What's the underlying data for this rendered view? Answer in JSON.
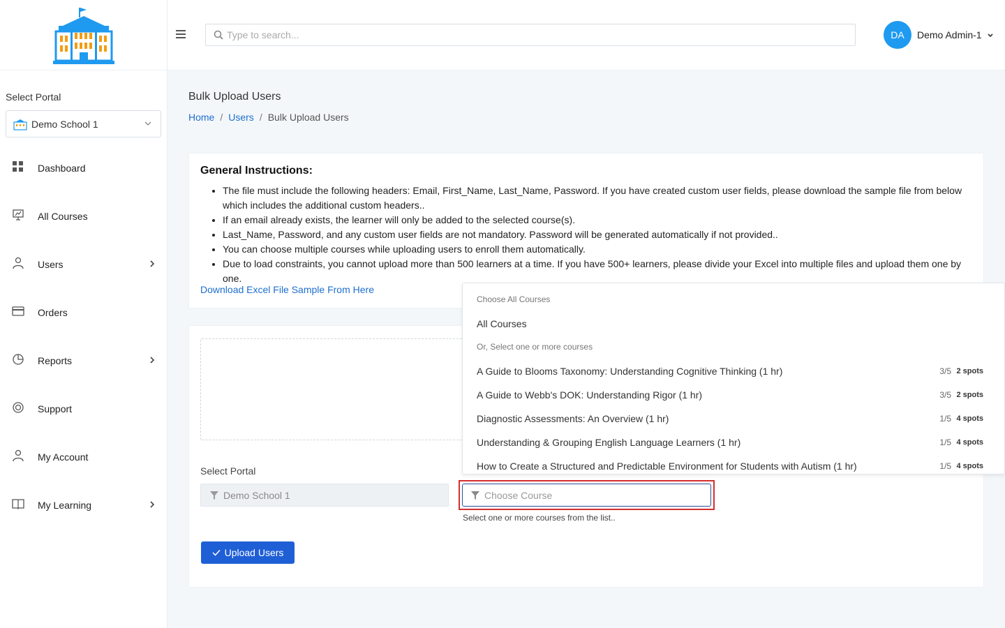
{
  "sidebar": {
    "select_portal_label": "Select Portal",
    "portal_value": "Demo School 1",
    "items": [
      {
        "label": "Dashboard",
        "icon": "dashboard-icon"
      },
      {
        "label": "All Courses",
        "icon": "presentation-icon"
      },
      {
        "label": "Users",
        "icon": "user-icon"
      },
      {
        "label": "Orders",
        "icon": "credit-card-icon"
      },
      {
        "label": "Reports",
        "icon": "pie-chart-icon"
      },
      {
        "label": "Support",
        "icon": "lifebuoy-icon"
      },
      {
        "label": "My Account",
        "icon": "user-icon"
      },
      {
        "label": "My Learning",
        "icon": "book-icon"
      }
    ]
  },
  "header": {
    "search_placeholder": "Type to search...",
    "avatar_initials": "DA",
    "user_name": "Demo Admin-1"
  },
  "page": {
    "title": "Bulk Upload Users",
    "breadcrumb": {
      "home": "Home",
      "users": "Users",
      "current": "Bulk Upload Users"
    }
  },
  "instructions": {
    "heading": "General Instructions:",
    "items": [
      "The file must include the following headers: Email, First_Name, Last_Name, Password. If you have created custom user fields, please download the sample file from below which includes the additional custom headers..",
      "If an email already exists, the learner will only be added to the selected course(s).",
      "Last_Name, Password, and any custom user fields are not mandatory. Password will be generated automatically if not provided..",
      "You can choose multiple courses while uploading users to enroll them automatically.",
      "Due to load constraints, you cannot upload more than 500 learners at a time. If you have 500+ learners, please divide your Excel into multiple files and upload them one by one."
    ],
    "download_link": "Download Excel File Sample From Here"
  },
  "form": {
    "select_portal_label": "Select Portal",
    "portal_value": "Demo School 1",
    "course_placeholder": "Choose Course",
    "course_hint": "Select one or more courses from the list..",
    "upload_button": "Upload Users"
  },
  "dropdown": {
    "group_all": "Choose All Courses",
    "all_courses": "All Courses",
    "group_select": "Or, Select one or more courses",
    "courses": [
      {
        "name": "A Guide to Blooms Taxonomy: Understanding Cognitive Thinking (1 hr)",
        "count": "3/5",
        "spots": "2 spots"
      },
      {
        "name": "A Guide to Webb's DOK: Understanding Rigor (1 hr)",
        "count": "3/5",
        "spots": "2 spots"
      },
      {
        "name": "Diagnostic Assessments: An Overview (1 hr)",
        "count": "1/5",
        "spots": "4 spots"
      },
      {
        "name": "Understanding & Grouping English Language Learners (1 hr)",
        "count": "1/5",
        "spots": "4 spots"
      },
      {
        "name": "How to Create a Structured and Predictable Environment for Students with Autism (1 hr)",
        "count": "1/5",
        "spots": "4 spots"
      }
    ]
  },
  "colors": {
    "accent": "#1e9af0",
    "link": "#1e6fd0",
    "primary_button": "#1f5fd6",
    "highlight_border": "#d32f2f"
  }
}
